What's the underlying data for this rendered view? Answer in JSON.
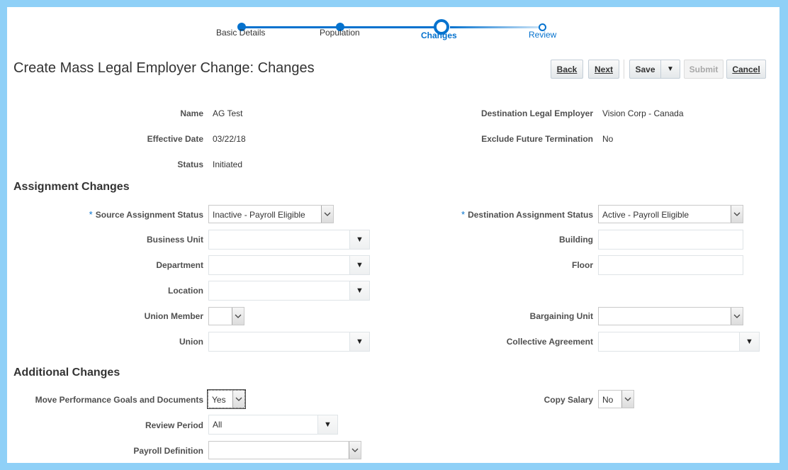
{
  "train": {
    "steps": [
      {
        "label": "Basic Details",
        "state": "done"
      },
      {
        "label": "Population",
        "state": "done"
      },
      {
        "label": "Changes",
        "state": "current"
      },
      {
        "label": "Review",
        "state": "next"
      }
    ]
  },
  "page": {
    "title": "Create Mass Legal Employer Change: Changes"
  },
  "toolbar": {
    "back": "Back",
    "next": "Next",
    "save": "Save",
    "submit": "Submit",
    "cancel": "Cancel"
  },
  "summary": {
    "name_label": "Name",
    "name_value": "AG Test",
    "effective_date_label": "Effective Date",
    "effective_date_value": "03/22/18",
    "status_label": "Status",
    "status_value": "Initiated",
    "dest_legal_employer_label": "Destination Legal Employer",
    "dest_legal_employer_value": "Vision Corp - Canada",
    "exclude_future_termination_label": "Exclude Future Termination",
    "exclude_future_termination_value": "No"
  },
  "assignment_changes": {
    "heading": "Assignment Changes",
    "required_marker": "*",
    "source_status_label": "Source Assignment Status",
    "source_status_value": "Inactive - Payroll Eligible",
    "dest_status_label": "Destination Assignment Status",
    "dest_status_value": "Active - Payroll Eligible",
    "business_unit_label": "Business Unit",
    "business_unit_value": "",
    "building_label": "Building",
    "building_value": "",
    "department_label": "Department",
    "department_value": "",
    "floor_label": "Floor",
    "floor_value": "",
    "location_label": "Location",
    "location_value": "",
    "union_member_label": "Union Member",
    "union_member_value": "",
    "bargaining_unit_label": "Bargaining Unit",
    "bargaining_unit_value": "",
    "union_label": "Union",
    "union_value": "",
    "collective_agreement_label": "Collective Agreement",
    "collective_agreement_value": ""
  },
  "additional_changes": {
    "heading": "Additional Changes",
    "move_goals_label": "Move Performance Goals and Documents",
    "move_goals_value": "Yes",
    "copy_salary_label": "Copy Salary",
    "copy_salary_value": "No",
    "review_period_label": "Review Period",
    "review_period_value": "All",
    "payroll_definition_label": "Payroll Definition",
    "payroll_definition_value": ""
  },
  "colors": {
    "accent": "#0572ce",
    "frame": "#8fd0f7"
  },
  "icons": {
    "dropdown": "triangle-down-icon",
    "select_arrow": "chevron-down-icon"
  }
}
